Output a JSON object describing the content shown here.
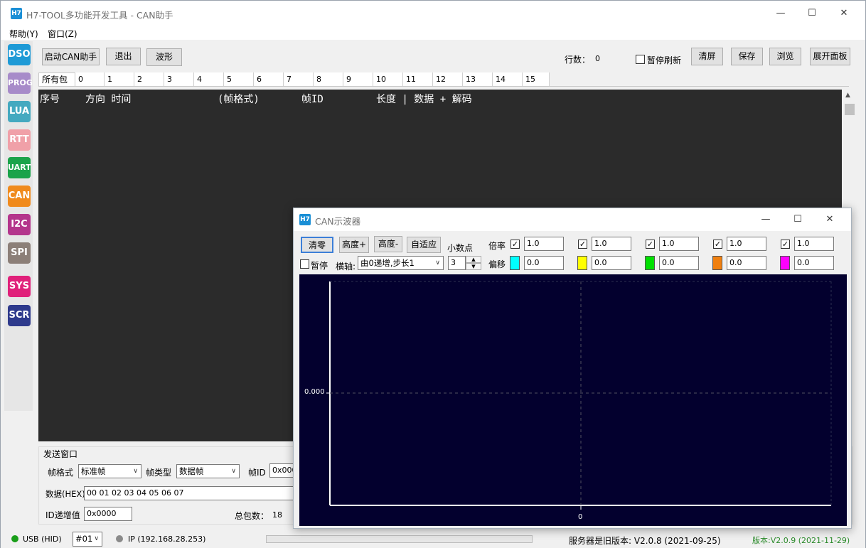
{
  "app": {
    "logo": "H7",
    "title": "H7-TOOL多功能开发工具 - CAN助手",
    "win_min": "—",
    "win_max": "☐",
    "win_close": "✕"
  },
  "menu": {
    "help": "帮助(Y)",
    "window": "窗口(Z)"
  },
  "sidebar": {
    "items": [
      {
        "label": "DSO",
        "color": "#1e9ad6"
      },
      {
        "label": "PROG",
        "color": "#a78bc9"
      },
      {
        "label": "LUA",
        "color": "#44a9c0"
      },
      {
        "label": "RTT",
        "color": "#f0a0a8"
      },
      {
        "label": "UART",
        "color": "#1aa34a"
      },
      {
        "label": "CAN",
        "color": "#f08a1c"
      },
      {
        "label": "I2C",
        "color": "#b4358c"
      },
      {
        "label": "SPI",
        "color": "#8c7f78"
      },
      {
        "label": "SYS",
        "color": "#e0207a"
      },
      {
        "label": "SCR",
        "color": "#2e3a8c"
      }
    ]
  },
  "toolbar": {
    "start": "启动CAN助手",
    "exit": "退出",
    "wave": "波形",
    "rows_label": "行数：",
    "rows_value": "0",
    "pause_refresh": "暂停刷新",
    "clear": "清屏",
    "save": "保存",
    "browse": "浏览",
    "expand": "展开面板"
  },
  "tabs": [
    "所有包",
    "0",
    "1",
    "2",
    "3",
    "4",
    "5",
    "6",
    "7",
    "8",
    "9",
    "10",
    "11",
    "12",
    "13",
    "14",
    "15"
  ],
  "log": {
    "col_index": "序号",
    "col_dir_time": "方向 时间",
    "col_format": "(帧格式)",
    "col_id": "帧ID",
    "col_len_data": "长度 | 数据 + 解码"
  },
  "send": {
    "group": "发送窗口",
    "frame_format_label": "帧格式",
    "frame_format_value": "标准帧",
    "frame_type_label": "帧类型",
    "frame_type_value": "数据帧",
    "frame_id_label": "帧ID",
    "frame_id_value": "0x000",
    "data_label": "数据(HEX)",
    "data_value": "00 01 02 03 04 05 06 07",
    "id_inc_label": "ID递增值",
    "id_inc_value": "0x0000",
    "total_label": "总包数：",
    "total_value": "18"
  },
  "status": {
    "usb": "USB (HID)",
    "usb_color": "#1a9e1a",
    "port": "#01",
    "ip": "IP (192.168.28.253)",
    "ip_color": "#8a8a8a",
    "server": "服务器是旧版本: V2.0.8 (2021-09-25)",
    "version": "版本:V2.0.9 (2021-11-29)",
    "version_color": "#2a8a2a"
  },
  "osc": {
    "logo": "H7",
    "title": "CAN示波器",
    "clear": "清零",
    "height_plus": "高度+",
    "height_minus": "高度-",
    "auto": "自适应",
    "decimals_label": "小数点",
    "decimals_value": "3",
    "pause": "暂停",
    "xaxis_label": "横轴:",
    "xaxis_value": "由0递增,步长1",
    "scale_label": "倍率",
    "offset_label": "偏移",
    "channels": [
      {
        "scale": "1.0",
        "offset": "0.0",
        "color": "#00ffff"
      },
      {
        "scale": "1.0",
        "offset": "0.0",
        "color": "#ffff00"
      },
      {
        "scale": "1.0",
        "offset": "0.0",
        "color": "#00e000"
      },
      {
        "scale": "1.0",
        "offset": "0.0",
        "color": "#f08010"
      },
      {
        "scale": "1.0",
        "offset": "0.0",
        "color": "#ff00ff"
      }
    ],
    "y_tick": "0.000",
    "x_tick": "0"
  }
}
